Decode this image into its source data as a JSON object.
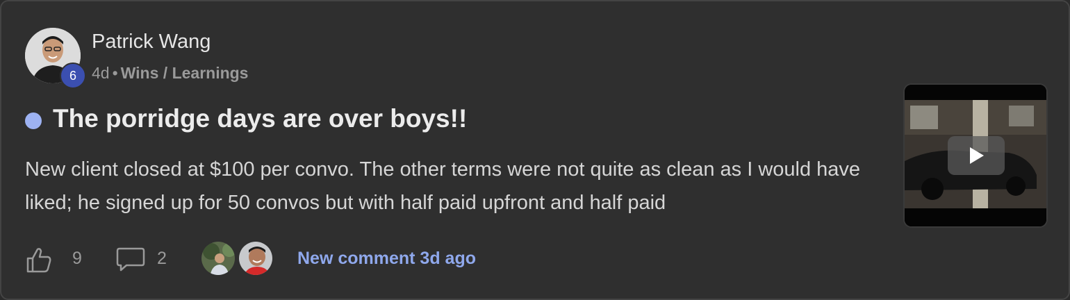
{
  "post": {
    "author": {
      "name": "Patrick Wang",
      "level": "6",
      "avatar_icon": "person-avatar"
    },
    "meta": {
      "time_ago": "4d",
      "separator": "•",
      "category": "Wins / Learnings"
    },
    "title": "The porridge days are over boys!!",
    "body_text": "New client closed at $100 per convo. The other terms were not quite as clean as I would have liked; he signed up for 50 convos but with half paid upfront and half paid",
    "thumbnail": {
      "type": "video",
      "icon": "play-icon"
    },
    "footer": {
      "like_icon": "thumbs-up-icon",
      "like_count": "9",
      "comment_icon": "comment-bubble-icon",
      "comment_count": "2",
      "commenter_avatars": [
        "commenter-avatar-1",
        "commenter-avatar-2"
      ],
      "new_comment_text": "New comment 3d ago"
    }
  },
  "colors": {
    "card_background": "#2f2f2f",
    "card_border": "#444444",
    "level_badge": "#3b4fb0",
    "unread_dot": "#9db2f2",
    "link_accent": "#8fa8ec"
  }
}
